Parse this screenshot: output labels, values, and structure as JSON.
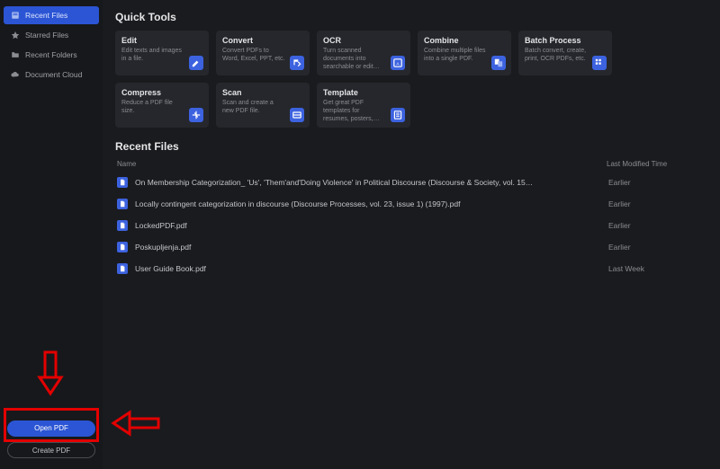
{
  "sidebar": {
    "items": [
      {
        "label": "Recent Files",
        "icon": "recent"
      },
      {
        "label": "Starred Files",
        "icon": "star"
      },
      {
        "label": "Recent Folders",
        "icon": "folder"
      },
      {
        "label": "Document Cloud",
        "icon": "cloud"
      }
    ],
    "open_label": "Open PDF",
    "create_label": "Create PDF"
  },
  "quick_tools": {
    "title": "Quick Tools",
    "tools": [
      {
        "title": "Edit",
        "desc": "Edit texts and images in a file.",
        "icon": "edit"
      },
      {
        "title": "Convert",
        "desc": "Convert PDFs to Word, Excel, PPT, etc.",
        "icon": "convert"
      },
      {
        "title": "OCR",
        "desc": "Turn scanned documents into searchable or edit…",
        "icon": "ocr"
      },
      {
        "title": "Combine",
        "desc": "Combine multiple files into a single PDF.",
        "icon": "combine"
      },
      {
        "title": "Batch Process",
        "desc": "Batch convert, create, print, OCR PDFs, etc.",
        "icon": "batch"
      },
      {
        "title": "Compress",
        "desc": "Reduce a PDF file size.",
        "icon": "compress"
      },
      {
        "title": "Scan",
        "desc": "Scan and create a new PDF file.",
        "icon": "scan"
      },
      {
        "title": "Template",
        "desc": "Get great PDF templates for resumes, posters,…",
        "icon": "template"
      }
    ]
  },
  "recent_files": {
    "title": "Recent Files",
    "col_name": "Name",
    "col_time": "Last Modified Time",
    "files": [
      {
        "name": "On Membership Categorization_ 'Us', 'Them'and'Doing Violence' in Political Discourse (Discourse & Society, vol. 15…",
        "time": "Earlier"
      },
      {
        "name": "Locally contingent categorization in discourse (Discourse Processes, vol. 23, issue 1) (1997).pdf",
        "time": "Earlier"
      },
      {
        "name": "LockedPDF.pdf",
        "time": "Earlier"
      },
      {
        "name": "Poskupljenja.pdf",
        "time": "Earlier"
      },
      {
        "name": "User Guide Book.pdf",
        "time": "Last Week"
      }
    ]
  }
}
